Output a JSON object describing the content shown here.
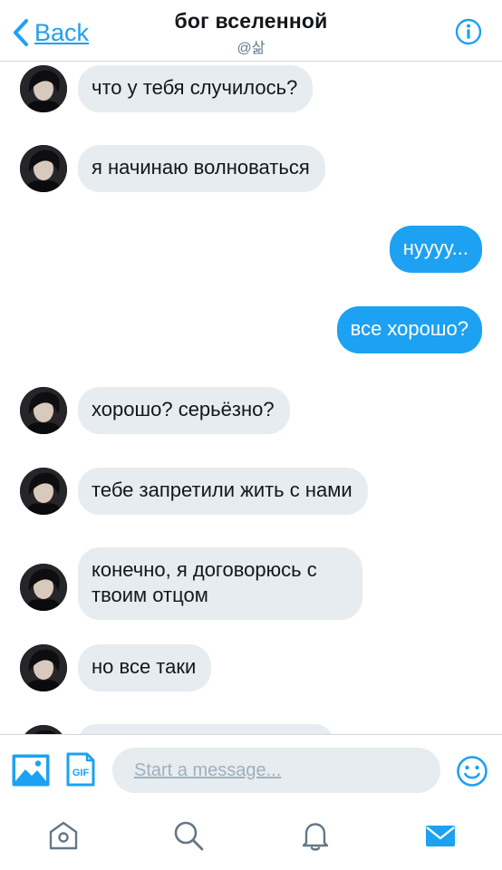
{
  "header": {
    "back_label": "Back",
    "title": "бог вселенной",
    "handle": "@삶",
    "back_icon": "chevron-left-icon",
    "info_icon": "info-icon"
  },
  "messages": [
    {
      "from": "them",
      "text": "что у тебя случилось?"
    },
    {
      "from": "them",
      "text": "я начинаю волноваться"
    },
    {
      "from": "me",
      "text": "нуууу..."
    },
    {
      "from": "me",
      "text": "все хорошо?"
    },
    {
      "from": "them",
      "text": "хорошо? серьёзно?"
    },
    {
      "from": "them",
      "text": "тебе запретили жить с нами"
    },
    {
      "from": "them",
      "text": "конечно, я договорюсь с твоим отцом"
    },
    {
      "from": "them",
      "text": "но все таки"
    }
  ],
  "composer": {
    "placeholder": "Start a message...",
    "image_icon": "image-icon",
    "gif_icon": "gif-icon",
    "emoji_icon": "emoji-icon"
  },
  "tabs": [
    {
      "name": "home",
      "icon": "home-icon",
      "active": false
    },
    {
      "name": "search",
      "icon": "search-icon",
      "active": false
    },
    {
      "name": "notifications",
      "icon": "bell-icon",
      "active": false
    },
    {
      "name": "messages",
      "icon": "mail-icon",
      "active": true
    }
  ],
  "colors": {
    "accent": "#1da1f2",
    "incoming_bubble": "#e6ecf0",
    "icon_gray": "#657786"
  }
}
